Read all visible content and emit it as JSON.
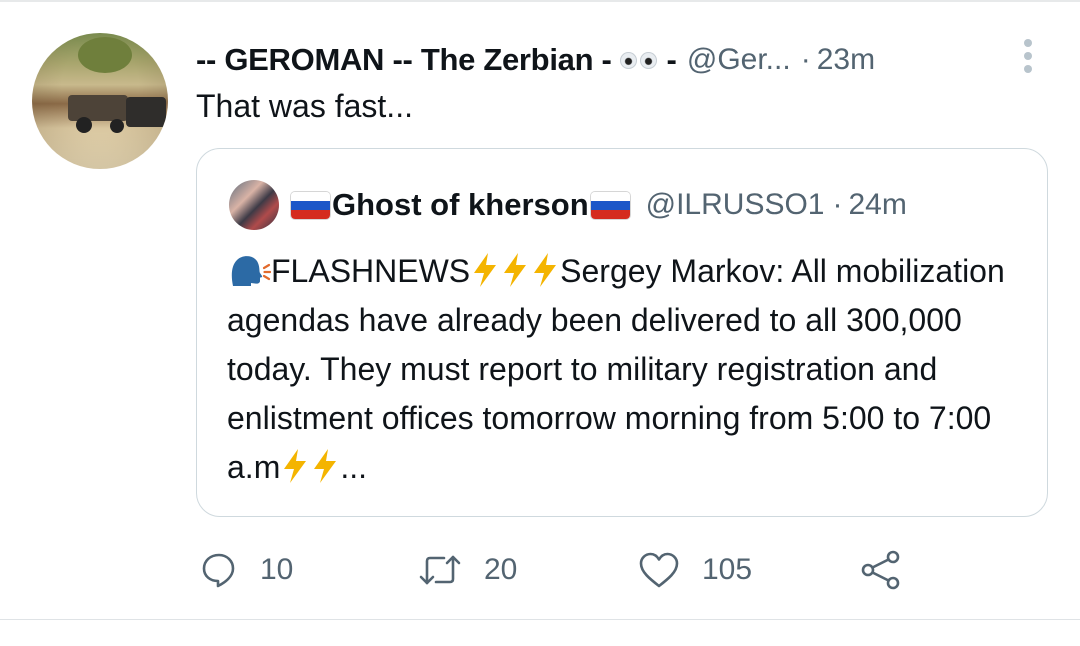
{
  "tweet": {
    "display_name": "-- GEROMAN -- The Zerbian -",
    "name_tail": "-",
    "handle": "@Ger...",
    "separator": "·",
    "time": "23m",
    "text": "That was fast..."
  },
  "quoted_tweet": {
    "display_name": "Ghost of kherson",
    "handle": "@ILRUSSO1",
    "separator": "·",
    "time": "24m",
    "body": {
      "part1": "FLASHNEWS",
      "part2": "Sergey Markov: All mobilization agendas have already been delivered to all 300,000 today. They must report to military registration and enlistment offices tomorrow morning from 5:00 to 7:00 a.m",
      "ellipsis": "..."
    }
  },
  "actions": {
    "reply_count": "10",
    "retweet_count": "20",
    "like_count": "105"
  },
  "icons": {
    "more": "more-vertical-icon",
    "reply": "reply-icon",
    "retweet": "retweet-icon",
    "like": "heart-icon",
    "share": "share-icon"
  },
  "colors": {
    "text": "#0f1419",
    "secondary": "#536471",
    "border": "#cfd9de",
    "bolt": "#f4b400"
  }
}
